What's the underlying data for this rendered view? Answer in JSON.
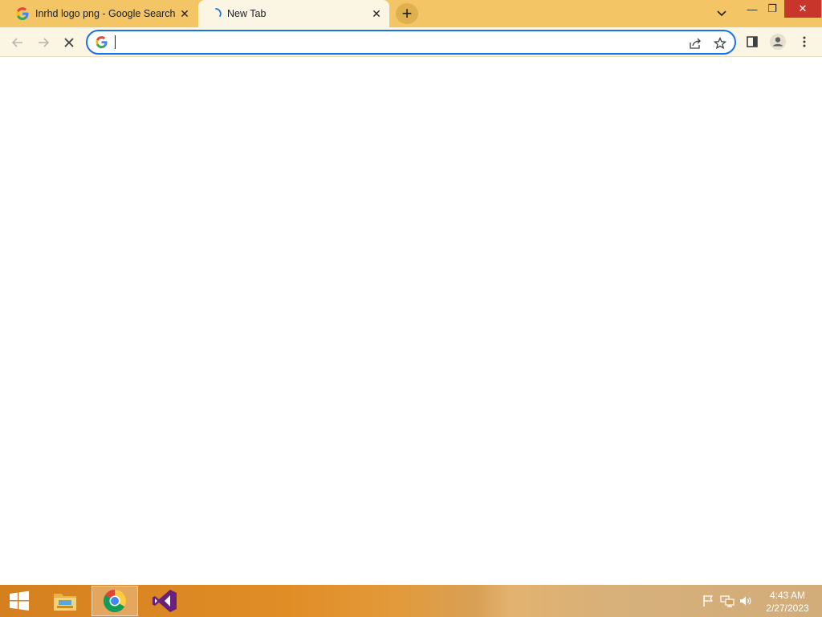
{
  "browser": {
    "tabs": [
      {
        "title": "Inrhd logo png - Google Search",
        "favicon": "google-g-icon",
        "active": false
      },
      {
        "title": "New Tab",
        "favicon": "loading-spinner-icon",
        "active": true
      }
    ],
    "tab_close_glyph": "✕",
    "new_tab_glyph": "+",
    "window_controls": {
      "minimize": "—",
      "maximize": "❐",
      "close": "✕"
    },
    "omnibox": {
      "value": "",
      "placeholder": ""
    },
    "nav_icons": [
      "back-arrow-icon",
      "forward-arrow-icon",
      "stop-loading-icon"
    ],
    "omnibox_icons": [
      "share-icon",
      "bookmark-star-icon"
    ],
    "toolbar_icons": [
      "side-panel-icon",
      "profile-avatar-icon",
      "menu-kebab-icon"
    ]
  },
  "taskbar": {
    "items": [
      "start-windows-icon",
      "file-explorer-icon",
      "chrome-icon",
      "visual-studio-icon"
    ],
    "active_item": "chrome-icon",
    "tray_icons": [
      "action-center-flag-icon",
      "network-icon",
      "volume-icon"
    ],
    "clock": {
      "time": "4:43 AM",
      "date": "2/27/2023"
    }
  },
  "colors": {
    "tabstrip": "#f3c564",
    "toolbar": "#fbf5e3",
    "omnibox_focus": "#1a73e8",
    "close_button": "#c7352b"
  }
}
